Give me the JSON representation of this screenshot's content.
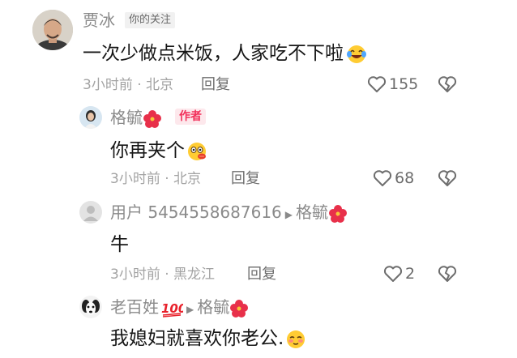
{
  "comments": [
    {
      "username": "贾冰",
      "tag": "你的关注",
      "text": "一次少做点米饭，人家吃不下啦",
      "time_location": "3小时前 · 北京",
      "reply_label": "回复",
      "likes": "155",
      "avatar_icon": "man-photo-avatar",
      "text_emoji": "laughing-crying-emoji"
    },
    {
      "username": "格毓",
      "name_emoji": "hibiscus-emoji",
      "tag": "作者",
      "text": "你再夹个",
      "time_location": "3小时前 · 北京",
      "reply_label": "回复",
      "likes": "68",
      "avatar_icon": "woman-photo-avatar",
      "text_emoji": "drooling-emoji"
    },
    {
      "username": "用户 5454558687616",
      "reply_to": "格毓",
      "reply_to_emoji": "hibiscus-emoji",
      "text": "牛",
      "time_location": "3小时前 · 黑龙江",
      "reply_label": "回复",
      "likes": "2",
      "avatar_icon": "default-user-avatar"
    },
    {
      "username": "老百姓",
      "name_emoji": "hundred-points-emoji",
      "reply_to": "格毓",
      "reply_to_emoji": "hibiscus-emoji",
      "text": "我媳妇就喜欢你老公.",
      "avatar_icon": "dog-photo-avatar",
      "text_emoji": "shy-face-emoji"
    }
  ],
  "colors": {
    "author_tag": "#f2305a",
    "meta_text": "#a3a3a3",
    "username": "#8a8a8a"
  }
}
